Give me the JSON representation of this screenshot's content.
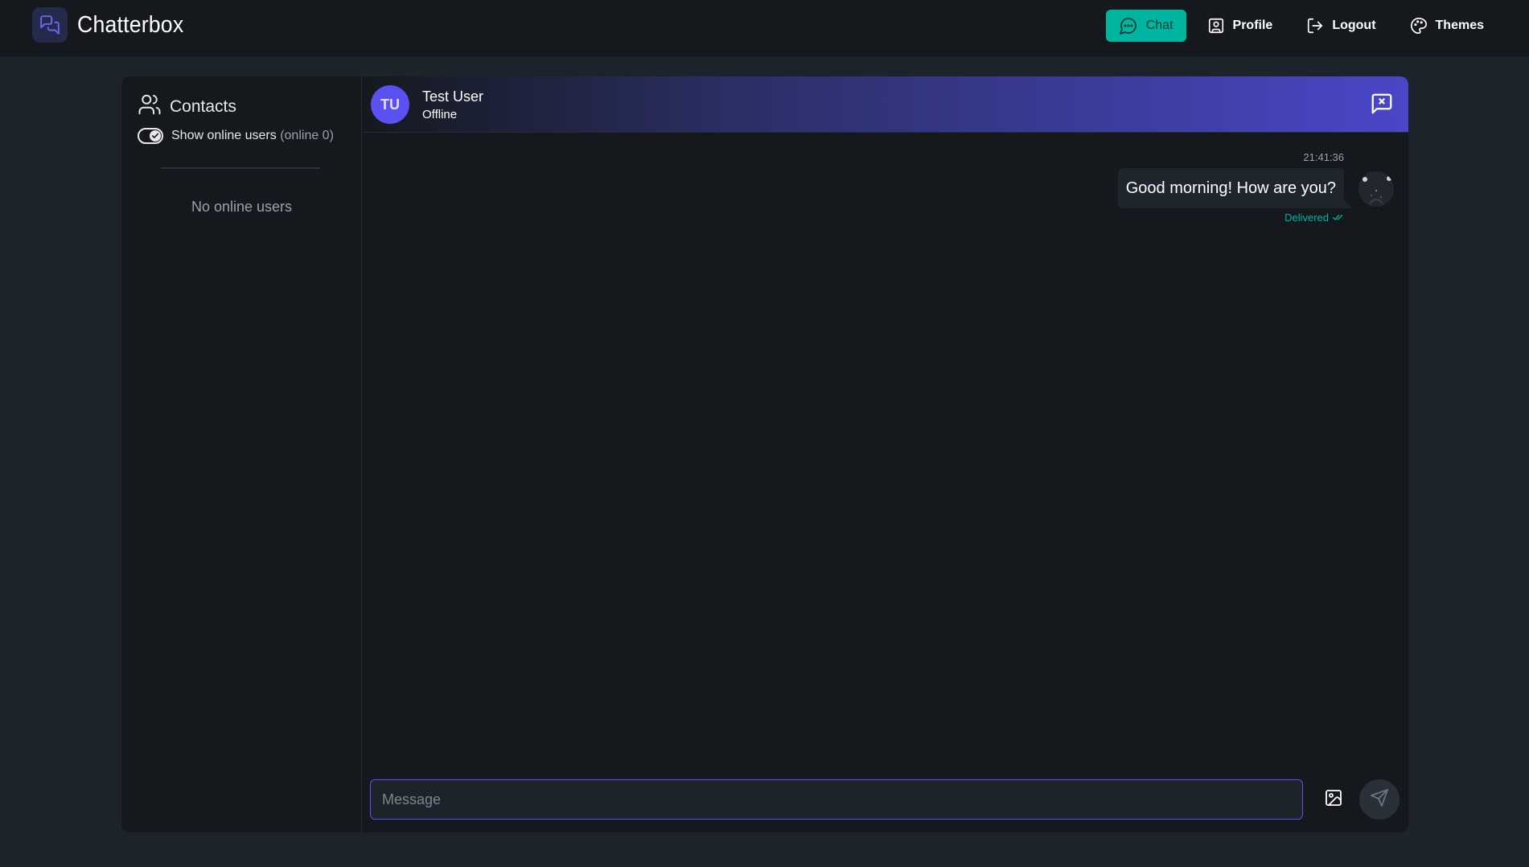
{
  "app": {
    "title": "Chatterbox",
    "accent_color": "#00b5a0",
    "brand_color": "#5b50f0"
  },
  "nav": {
    "items": [
      {
        "label": "Chat",
        "icon": "message-circle-icon",
        "active": true
      },
      {
        "label": "Profile",
        "icon": "user-square-icon",
        "active": false
      },
      {
        "label": "Logout",
        "icon": "logout-icon",
        "active": false
      },
      {
        "label": "Themes",
        "icon": "palette-icon",
        "active": false
      }
    ]
  },
  "sidebar": {
    "title": "Contacts",
    "toggle_label": "Show online users",
    "online_count": "(online 0)",
    "toggle_checked": true,
    "empty_text": "No online users"
  },
  "chat": {
    "peer_initials": "TU",
    "peer_name": "Test User",
    "peer_status": "Offline",
    "messages": [
      {
        "time": "21:41:36",
        "text": "Good morning! How are you?",
        "status": "Delivered"
      }
    ],
    "input_placeholder": "Message"
  }
}
